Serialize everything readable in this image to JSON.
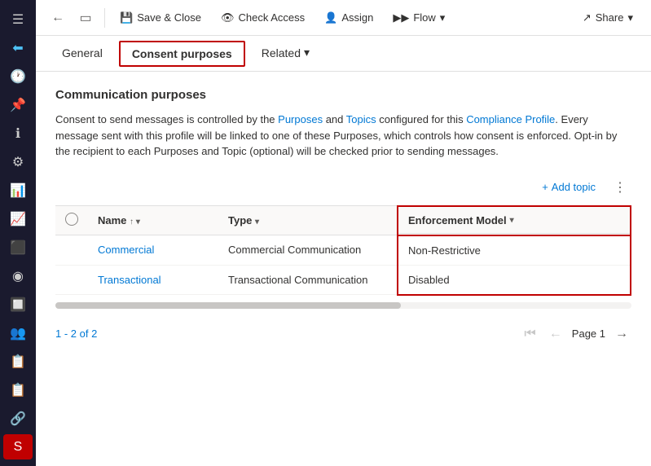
{
  "toolbar": {
    "back_icon": "←",
    "restore_icon": "⬜",
    "save_close": "Save & Close",
    "check_access": "Check Access",
    "assign": "Assign",
    "flow": "Flow",
    "flow_dropdown": "▾",
    "share": "Share",
    "share_dropdown": "▾"
  },
  "tabs": {
    "general": "General",
    "consent_purposes": "Consent purposes",
    "related": "Related",
    "related_dropdown": "▾"
  },
  "content": {
    "section_title": "Communication purposes",
    "info_text_1": "Consent to send messages is controlled by the Purposes and Topics configured for this Compliance Profile.",
    "info_text_2": "Every message sent with this profile will be linked to one of these Purposes, which controls how consent is enforced. Opt-in by the recipient to each Purposes and Topic (optional) will be checked prior to sending messages.",
    "add_topic_label": "+ Add topic",
    "more_options": "⋮"
  },
  "table": {
    "headers": {
      "select": "",
      "name": "Name",
      "name_sort": "↑",
      "name_filter": "▾",
      "type": "Type",
      "type_filter": "▾",
      "enforcement": "Enforcement Model",
      "enforcement_filter": "▾"
    },
    "rows": [
      {
        "name": "Commercial",
        "type": "Commercial Communication",
        "enforcement": "Non-Restrictive"
      },
      {
        "name": "Transactional",
        "type": "Transactional Communication",
        "enforcement": "Disabled"
      }
    ]
  },
  "pagination": {
    "count_colored": "1 - 2 of 2",
    "first_page_icon": "⏮",
    "prev_icon": "←",
    "page_label": "Page 1",
    "next_icon": "→"
  },
  "sidebar": {
    "menu_icon": "☰",
    "icons": [
      "🕐",
      "📌",
      "ℹ",
      "⚙",
      "📊",
      "📈",
      "⬛",
      "◉",
      "🔲",
      "👥",
      "⬜",
      "📋",
      "🔗"
    ],
    "bottom_icon": "S"
  }
}
